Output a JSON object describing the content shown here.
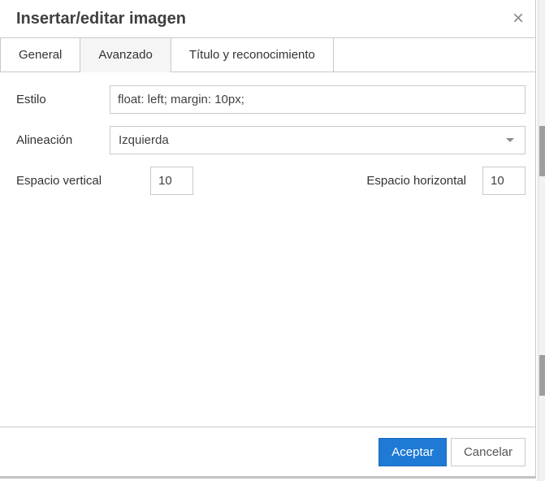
{
  "dialog": {
    "title": "Insertar/editar imagen",
    "close": "×"
  },
  "tabs": {
    "items": [
      {
        "label": "General",
        "active": false
      },
      {
        "label": "Avanzado",
        "active": true
      },
      {
        "label": "Título y reconocimiento",
        "active": false
      }
    ]
  },
  "form": {
    "estilo": {
      "label": "Estilo",
      "value": "float: left; margin: 10px;"
    },
    "alineacion": {
      "label": "Alineación",
      "value": "Izquierda"
    },
    "espacio_vertical": {
      "label": "Espacio vertical",
      "value": "10"
    },
    "espacio_horizontal": {
      "label": "Espacio horizontal",
      "value": "10"
    }
  },
  "footer": {
    "accept": "Aceptar",
    "cancel": "Cancelar"
  },
  "colors": {
    "primary": "#1e7ad4",
    "primary_border": "#1a6cc0",
    "border": "#c9c9c9",
    "text": "#333333",
    "active_tab_bg": "#f5f5f5",
    "scrollbar_thumb": "#9e9e9e"
  }
}
